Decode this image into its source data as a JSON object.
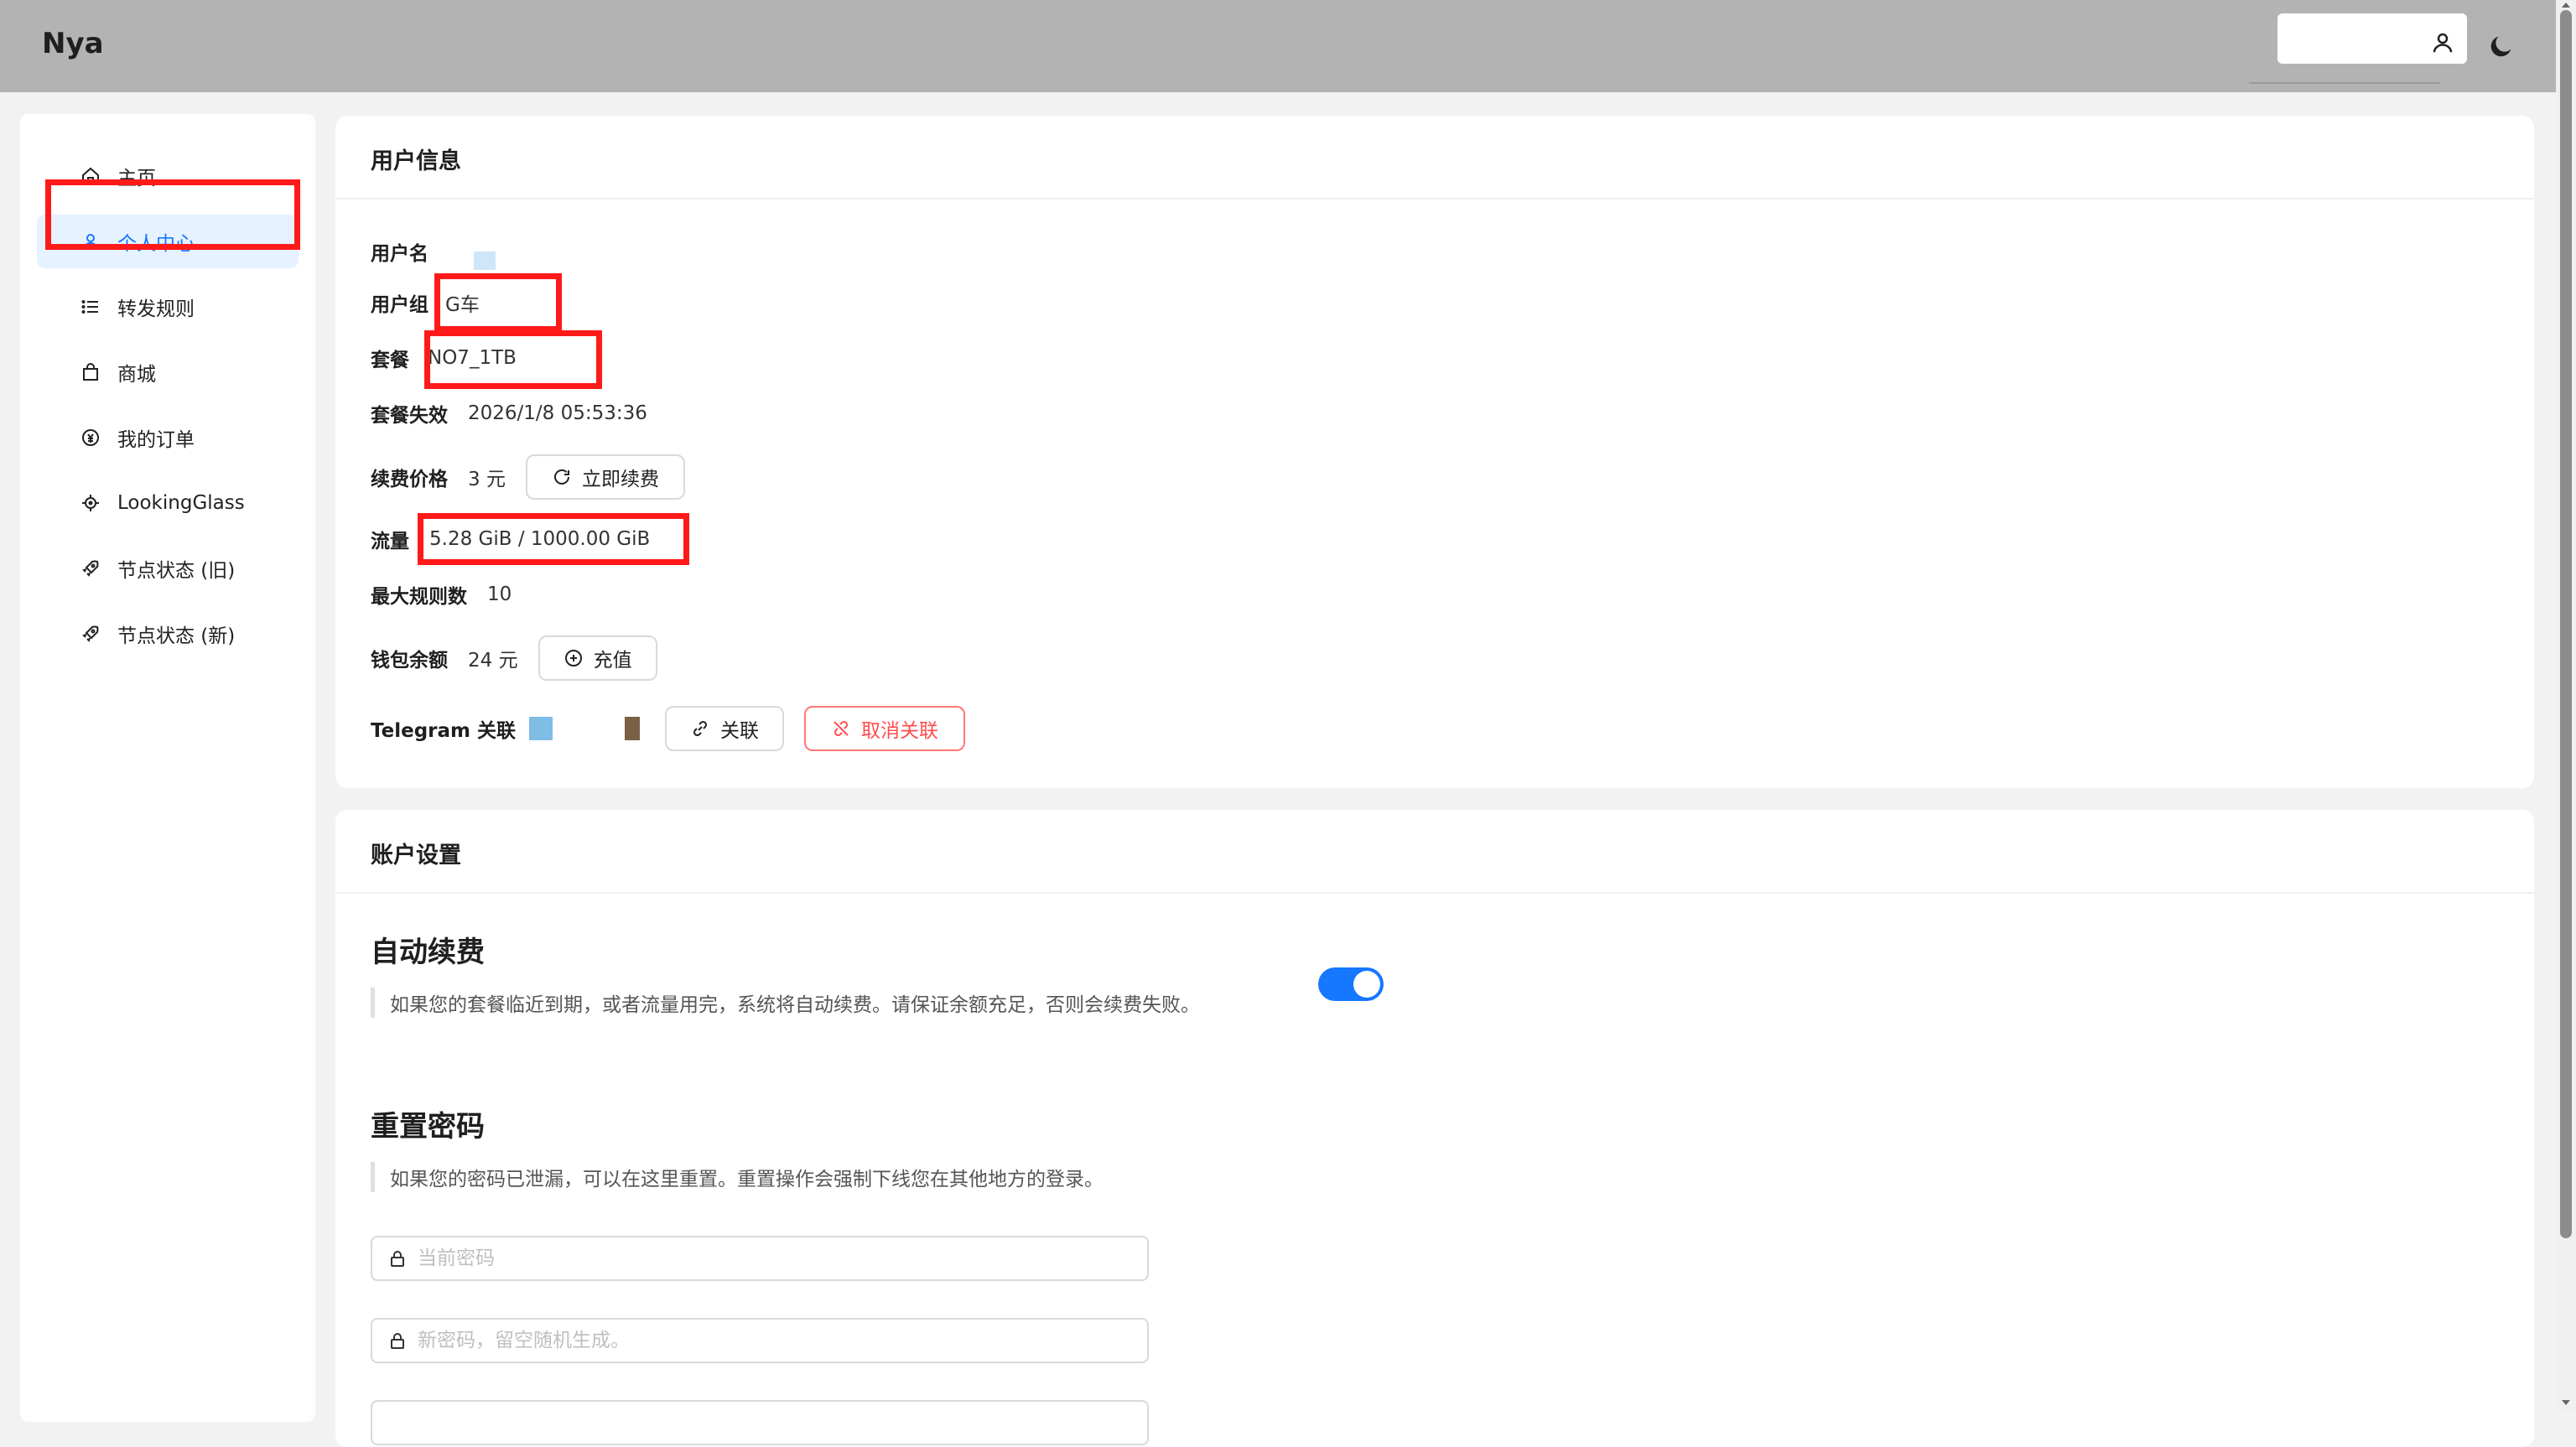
{
  "header": {
    "brand": "Nya"
  },
  "sidebar": {
    "items": [
      {
        "label": "主页",
        "icon": "home-icon"
      },
      {
        "label": "个人中心",
        "icon": "user-icon",
        "active": true
      },
      {
        "label": "转发规则",
        "icon": "list-icon"
      },
      {
        "label": "商城",
        "icon": "shopping-bag-icon"
      },
      {
        "label": "我的订单",
        "icon": "order-icon"
      },
      {
        "label": "LookingGlass",
        "icon": "aim-icon"
      },
      {
        "label": "节点状态 (旧)",
        "icon": "rocket-icon"
      },
      {
        "label": "节点状态 (新)",
        "icon": "rocket-icon"
      }
    ]
  },
  "user_info": {
    "title": "用户信息",
    "username_label": "用户名",
    "group_label": "用户组",
    "group_value": "G车",
    "plan_label": "套餐",
    "plan_value": "NO7_1TB",
    "plan_expire_label": "套餐失效",
    "plan_expire_value": "2026/1/8 05:53:36",
    "renew_price_label": "续费价格",
    "renew_price_value": "3 元",
    "renew_button": "立即续费",
    "traffic_label": "流量",
    "traffic_value": "5.28 GiB / 1000.00 GiB",
    "max_rules_label": "最大规则数",
    "max_rules_value": "10",
    "wallet_label": "钱包余额",
    "wallet_value": "24 元",
    "recharge_button": "充值",
    "telegram_label": "Telegram 关联",
    "link_button": "关联",
    "unlink_button": "取消关联"
  },
  "account_settings": {
    "title": "账户设置",
    "auto_renew": {
      "title": "自动续费",
      "description": "如果您的套餐临近到期，或者流量用完，系统将自动续费。请保证余额充足，否则会续费失败。",
      "enabled": true
    },
    "reset_password": {
      "title": "重置密码",
      "description": "如果您的密码已泄漏，可以在这里重置。重置操作会强制下线您在其他地方的登录。",
      "current_password_placeholder": "当前密码",
      "new_password_placeholder": "新密码，留空随机生成。"
    }
  },
  "colors": {
    "accent": "#1677ff",
    "highlight": "#ff1a1a",
    "danger": "#ff4d4f",
    "header_bg": "#b3b3b3"
  }
}
